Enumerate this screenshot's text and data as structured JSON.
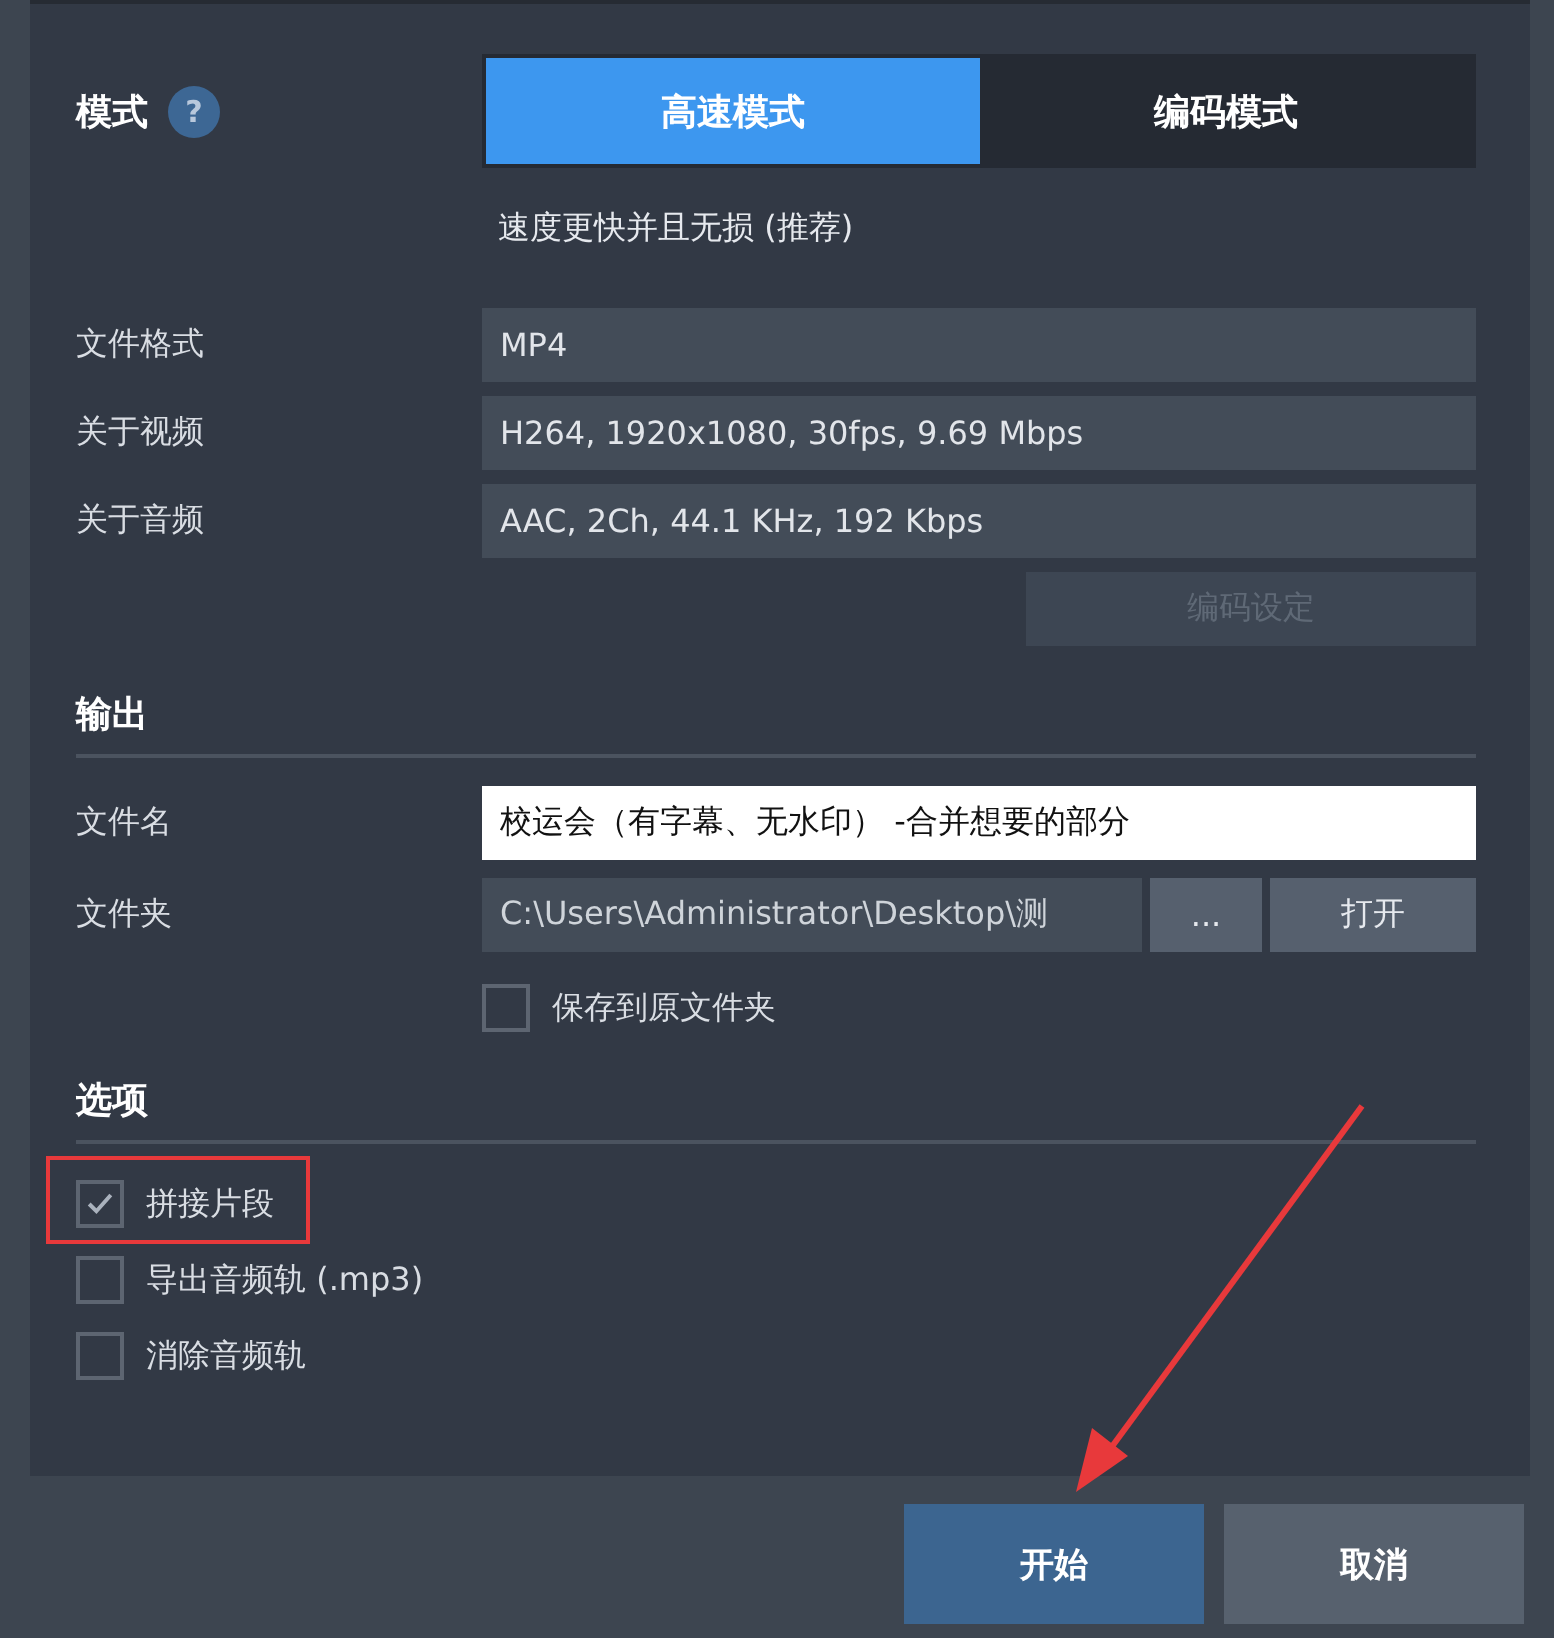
{
  "mode": {
    "label": "模式",
    "help": "?",
    "options": [
      {
        "label": "高速模式",
        "selected": true
      },
      {
        "label": "编码模式",
        "selected": false
      }
    ],
    "description": "速度更快并且无损 (推荐)"
  },
  "info": [
    {
      "label": "文件格式",
      "value": "MP4"
    },
    {
      "label": "关于视频",
      "value": "H264, 1920x1080, 30fps, 9.69 Mbps"
    },
    {
      "label": "关于音频",
      "value": "AAC, 2Ch, 44.1 KHz, 192 Kbps"
    }
  ],
  "encode_settings": {
    "label": "编码设定",
    "disabled": true
  },
  "output": {
    "heading": "输出",
    "filename_label": "文件名",
    "filename": "校运会（有字幕、无水印） -合并想要的部分",
    "folder_label": "文件夹",
    "folder": "C:\\Users\\Administrator\\Desktop\\测",
    "browse": "...",
    "open": "打开",
    "save_original": {
      "label": "保存到原文件夹",
      "checked": false
    }
  },
  "options": {
    "heading": "选项",
    "items": [
      {
        "label": "拼接片段",
        "checked": true,
        "highlighted": true
      },
      {
        "label": "导出音频轨 (.mp3)",
        "checked": false,
        "highlighted": false
      },
      {
        "label": "消除音频轨",
        "checked": false,
        "highlighted": false
      }
    ]
  },
  "buttons": [
    {
      "label": "开始",
      "kind": "primary"
    },
    {
      "label": "取消",
      "kind": "secondary"
    }
  ],
  "pointer_arrow": true
}
